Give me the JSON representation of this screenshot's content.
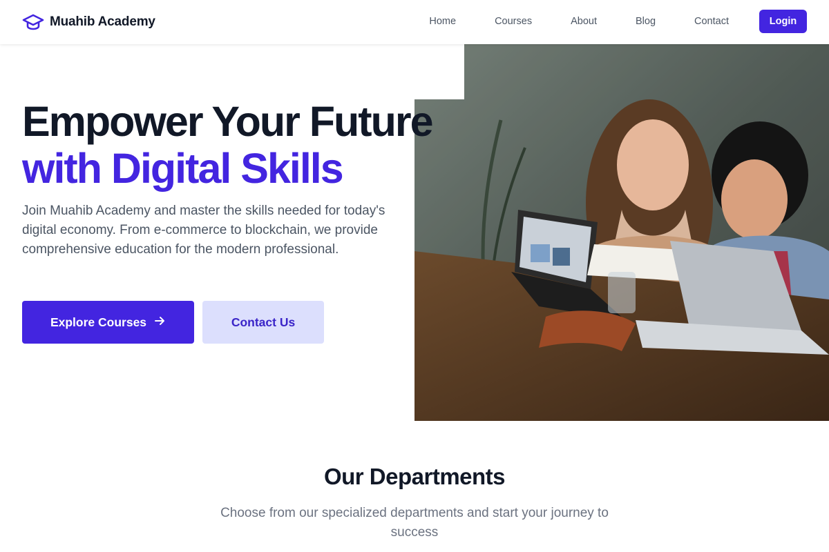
{
  "header": {
    "brand_name": "Muahib Academy",
    "brand_icon": "graduation-cap-icon",
    "nav": [
      "Home",
      "Courses",
      "About",
      "Blog",
      "Contact"
    ],
    "login_label": "Login"
  },
  "hero": {
    "title_line1": "Empower Your Future",
    "title_line2": "with Digital Skills",
    "description": "Join Muahib Academy and master the skills needed for today's digital economy. From e-commerce to blockchain, we provide comprehensive education for the modern professional.",
    "primary_button": "Explore Courses",
    "primary_button_icon": "arrow-right-icon",
    "secondary_button": "Contact Us",
    "image": "photo-students-laughing-with-laptops"
  },
  "departments": {
    "title": "Our Departments",
    "subtitle": "Choose from our specialized departments and start your journey to success"
  },
  "colors": {
    "accent": "#4325e0",
    "heading": "#111827",
    "body_text": "#4b5563",
    "secondary_button_bg": "#dcdffd"
  }
}
